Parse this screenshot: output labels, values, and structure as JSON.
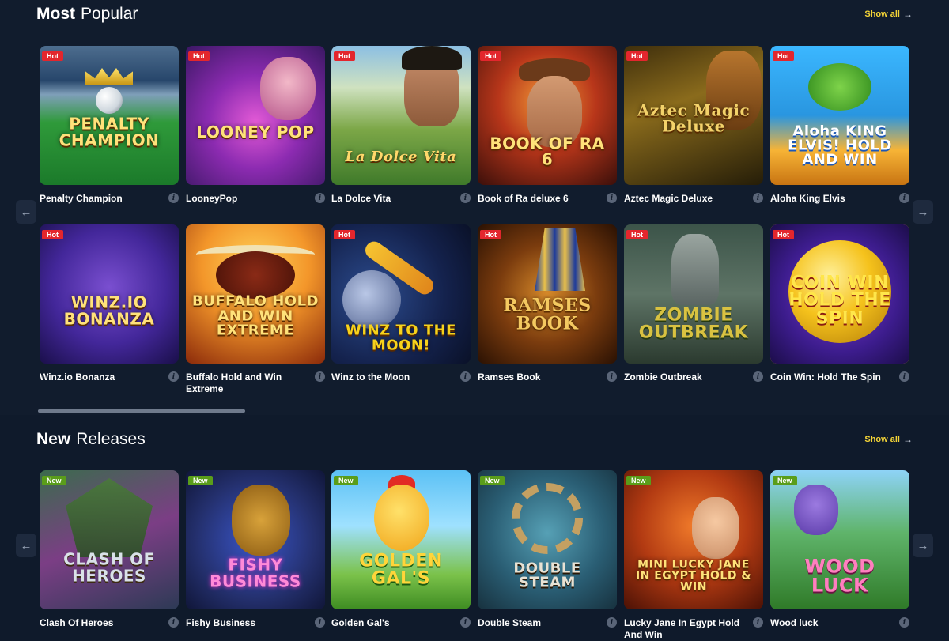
{
  "popular": {
    "title_bold": "Most",
    "title_rest": "Popular",
    "show_all": "Show all",
    "arrow_glyph": "→",
    "prev_glyph": "←",
    "next_glyph": "→",
    "games": [
      {
        "name": "Penalty Champion",
        "badge": "Hot",
        "art_text": "PENALTY CHAMPION"
      },
      {
        "name": "LooneyPop",
        "badge": "Hot",
        "art_text": "LOONEY POP"
      },
      {
        "name": "La Dolce Vita",
        "badge": "Hot",
        "art_text": "La Dolce Vita"
      },
      {
        "name": "Book of Ra deluxe 6",
        "badge": "Hot",
        "art_text": "BOOK OF RA 6"
      },
      {
        "name": "Aztec Magic Deluxe",
        "badge": "Hot",
        "art_text": "Aztec Magic Deluxe"
      },
      {
        "name": "Aloha King Elvis",
        "badge": "Hot",
        "art_text": "Aloha KING ELVIS! HOLD AND WIN"
      },
      {
        "name": "Winz.io Bonanza",
        "badge": "Hot",
        "art_text": "WINZ.IO BONANZA"
      },
      {
        "name": "Buffalo Hold and Win Extreme",
        "badge": "",
        "art_text": "BUFFALO HOLD AND WIN EXTREME"
      },
      {
        "name": "Winz to the Moon",
        "badge": "Hot",
        "art_text": "WINZ TO THE MOON!"
      },
      {
        "name": "Ramses Book",
        "badge": "Hot",
        "art_text": "RAMSES BOOK"
      },
      {
        "name": "Zombie Outbreak",
        "badge": "Hot",
        "art_text": "ZOMBIE OUTBREAK"
      },
      {
        "name": "Coin Win: Hold The Spin",
        "badge": "Hot",
        "art_text": "COIN WIN HOLD THE SPIN"
      }
    ]
  },
  "new_releases": {
    "title_bold": "New",
    "title_rest": "Releases",
    "show_all": "Show all",
    "arrow_glyph": "→",
    "prev_glyph": "←",
    "next_glyph": "→",
    "games": [
      {
        "name": "Clash Of Heroes",
        "badge": "New",
        "art_text": "CLASH OF HEROES"
      },
      {
        "name": "Fishy Business",
        "badge": "New",
        "art_text": "FISHY BUSINESS"
      },
      {
        "name": "Golden Gal's",
        "badge": "New",
        "art_text": "GOLDEN GAL'S"
      },
      {
        "name": "Double Steam",
        "badge": "New",
        "art_text": "DOUBLE STEAM"
      },
      {
        "name": "Lucky Jane In Egypt Hold And Win",
        "badge": "New",
        "art_text": "MINI LUCKY JANE IN EGYPT HOLD & WIN"
      },
      {
        "name": "Wood luck",
        "badge": "New",
        "art_text": "WOOD LUCK"
      }
    ]
  },
  "info_glyph": "i",
  "colors": {
    "accent": "#f4d437",
    "hot_badge": "#e3262d",
    "new_badge": "#5a9d1a",
    "background": "#111c2d"
  }
}
